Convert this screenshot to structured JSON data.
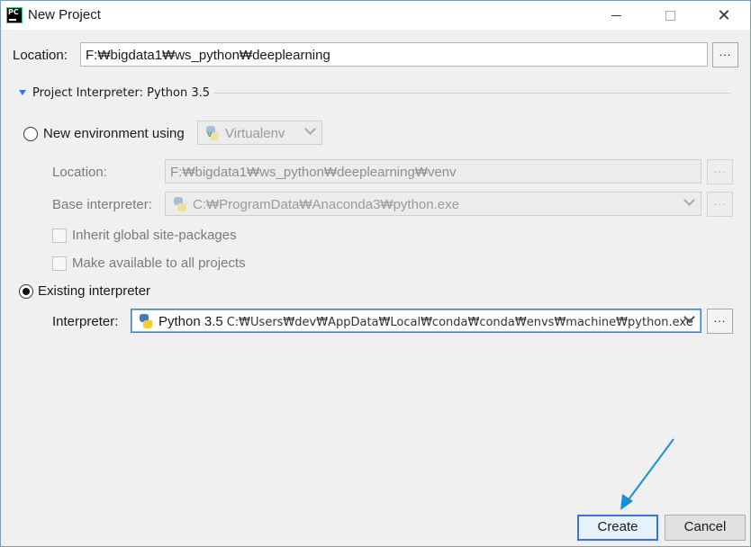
{
  "window": {
    "title": "New Project",
    "app_icon": "pycharm-icon",
    "controls": [
      "minimize-icon",
      "maximize-icon",
      "close-icon"
    ]
  },
  "location": {
    "label": "Location:",
    "value": "F:₩bigdata1₩ws_python₩deeplearning",
    "browse_label": "..."
  },
  "interpreter_section": {
    "title": "Project Interpreter: Python 3.5",
    "expanded": true
  },
  "new_env": {
    "label": "New environment using",
    "selected": false,
    "tool": "Virtualenv",
    "location_label": "Location:",
    "location_value": "F:₩bigdata1₩ws_python₩deeplearning₩venv",
    "base_label": "Base interpreter:",
    "base_value": "C:₩ProgramData₩Anaconda3₩python.exe",
    "inherit_label": "Inherit global site-packages",
    "inherit_checked": false,
    "available_label": "Make available to all projects",
    "available_checked": false,
    "browse_label": "..."
  },
  "existing": {
    "label": "Existing interpreter",
    "selected": true,
    "interpreter_label": "Interpreter:",
    "interpreter_name": "Python 3.5",
    "interpreter_path": "C:₩Users₩dev₩AppData₩Local₩conda₩conda₩envs₩machine₩python.exe",
    "browse_label": "..."
  },
  "buttons": {
    "create": "Create",
    "cancel": "Cancel"
  },
  "colors": {
    "accent": "#3574f0",
    "annotation_arrow": "#1a8fd8"
  }
}
